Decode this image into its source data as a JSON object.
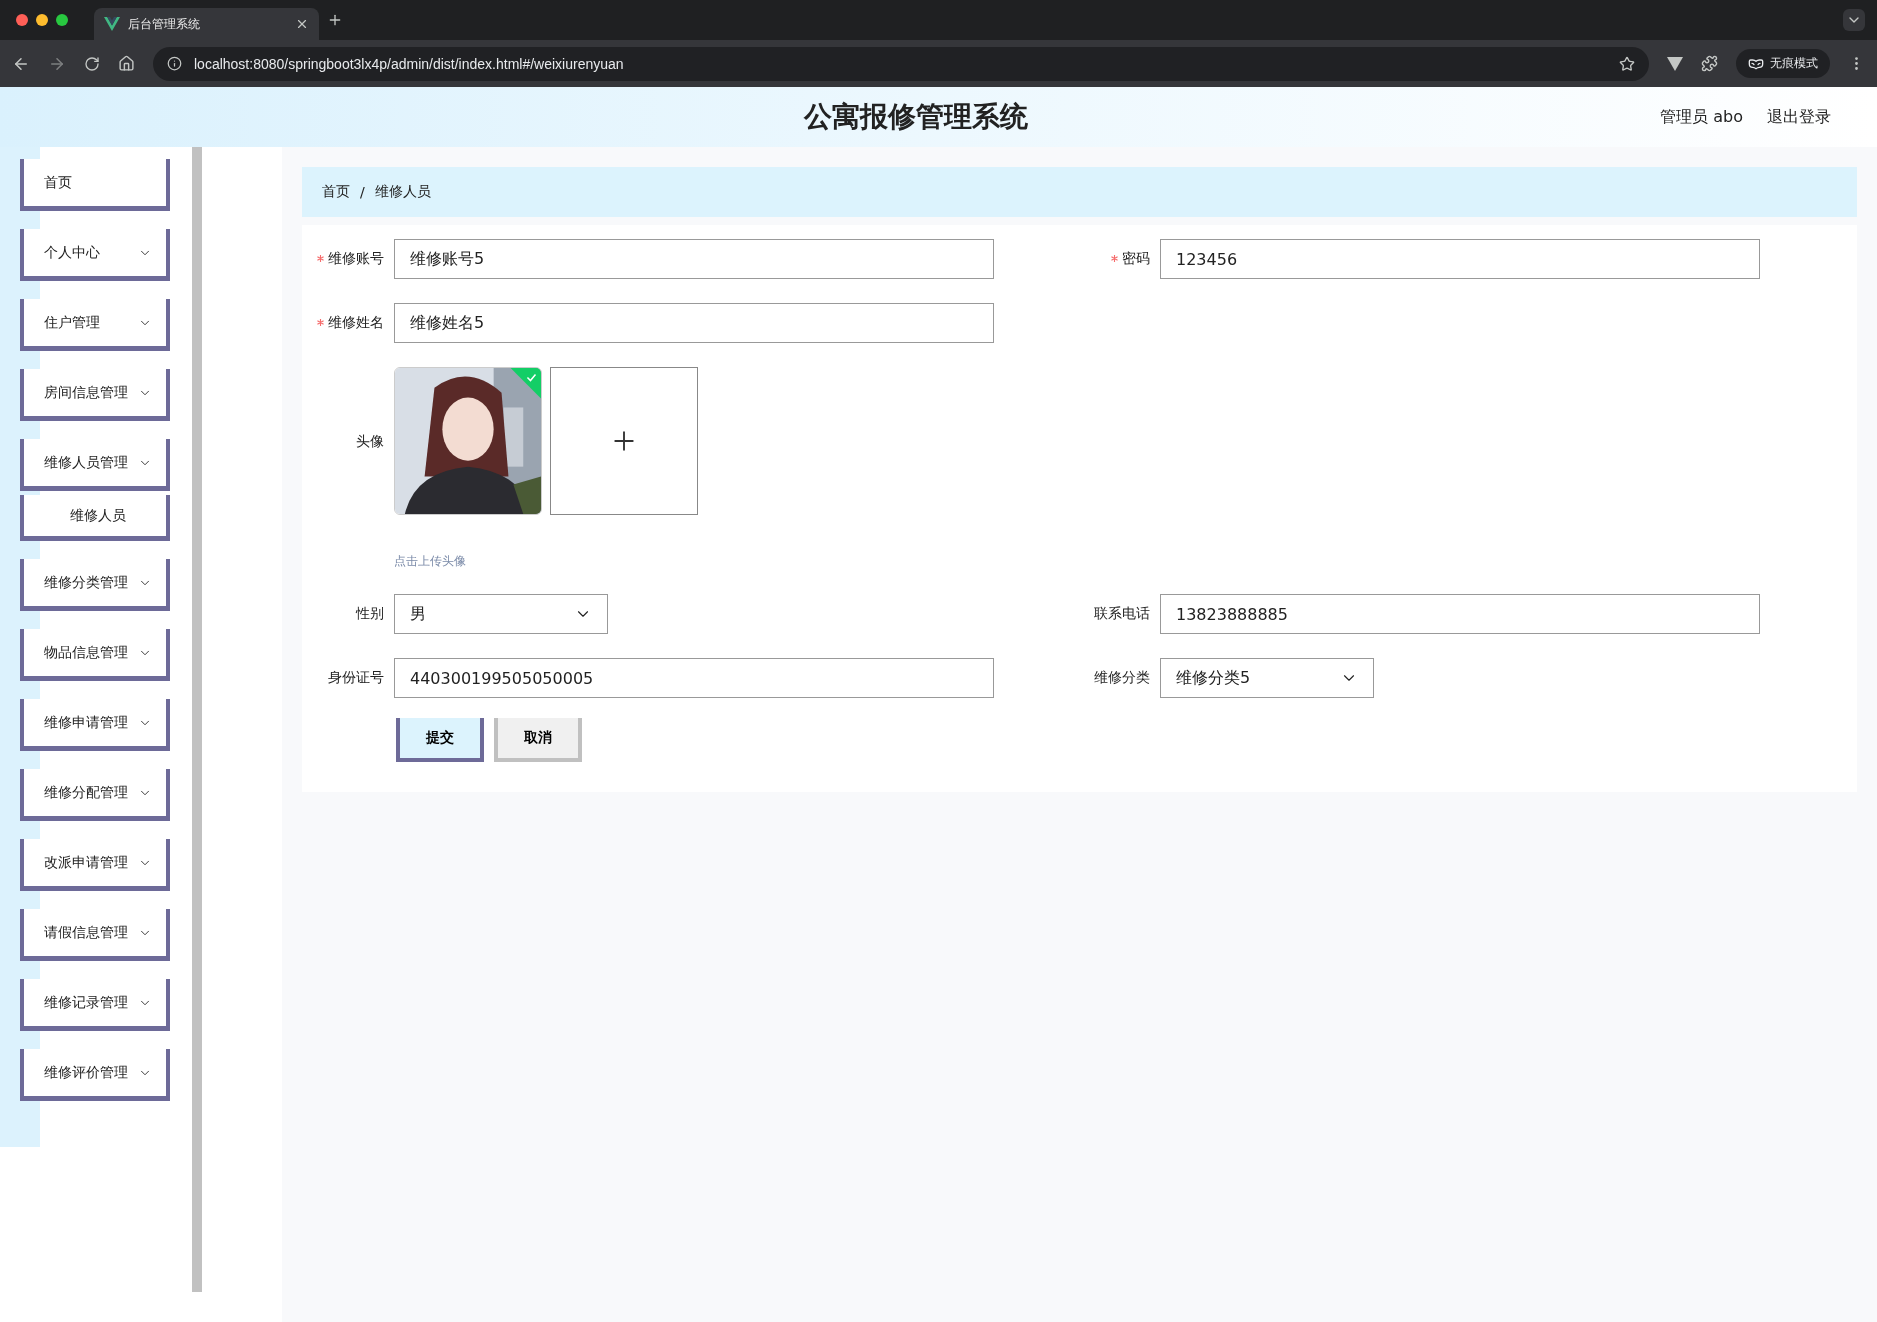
{
  "browser": {
    "tab_title": "后台管理系统",
    "url": "localhost:8080/springboot3lx4p/admin/dist/index.html#/weixiurenyuan",
    "incognito_label": "无痕模式"
  },
  "header": {
    "title": "公寓报修管理系统",
    "user": "管理员 abo",
    "logout": "退出登录"
  },
  "sidebar": {
    "items": [
      {
        "label": "首页",
        "kind": "link"
      },
      {
        "label": "个人中心",
        "kind": "menu"
      },
      {
        "label": "住户管理",
        "kind": "menu"
      },
      {
        "label": "房间信息管理",
        "kind": "menu"
      },
      {
        "label": "维修人员管理",
        "kind": "menu",
        "children": [
          {
            "label": "维修人员"
          }
        ]
      },
      {
        "label": "维修分类管理",
        "kind": "menu"
      },
      {
        "label": "物品信息管理",
        "kind": "menu"
      },
      {
        "label": "维修申请管理",
        "kind": "menu"
      },
      {
        "label": "维修分配管理",
        "kind": "menu"
      },
      {
        "label": "改派申请管理",
        "kind": "menu"
      },
      {
        "label": "请假信息管理",
        "kind": "menu"
      },
      {
        "label": "维修记录管理",
        "kind": "menu"
      },
      {
        "label": "维修评价管理",
        "kind": "menu"
      }
    ]
  },
  "breadcrumb": {
    "items": [
      "首页",
      "维修人员"
    ],
    "separators": [
      "/"
    ]
  },
  "form": {
    "rows": [
      {
        "fields": [
          {
            "label": "维修账号",
            "required": true,
            "kind": "text",
            "value": "维修账号5"
          },
          {
            "label": "密码",
            "required": true,
            "kind": "text",
            "value": "123456"
          }
        ]
      },
      {
        "fields": [
          {
            "label": "维修姓名",
            "required": true,
            "kind": "text",
            "value": "维修姓名5"
          }
        ]
      },
      {
        "fields": [
          {
            "label": "头像",
            "required": false,
            "kind": "upload",
            "files": [
              {
                "kind": "picture",
                "uploaded": true
              }
            ],
            "hint": "点击上传头像"
          }
        ]
      },
      {
        "fields": [
          {
            "label": "性别",
            "required": false,
            "kind": "select",
            "value": "男"
          },
          {
            "label": "联系电话",
            "required": false,
            "kind": "text",
            "value": "13823888885"
          }
        ]
      },
      {
        "fields": [
          {
            "label": "身份证号",
            "required": false,
            "kind": "text",
            "value": "440300199505050005"
          },
          {
            "label": "维修分类",
            "required": false,
            "kind": "select",
            "value": "维修分类5"
          }
        ]
      }
    ],
    "buttons": [
      {
        "label": "提交",
        "kind": "primary"
      },
      {
        "label": "取消",
        "kind": "default"
      }
    ]
  }
}
